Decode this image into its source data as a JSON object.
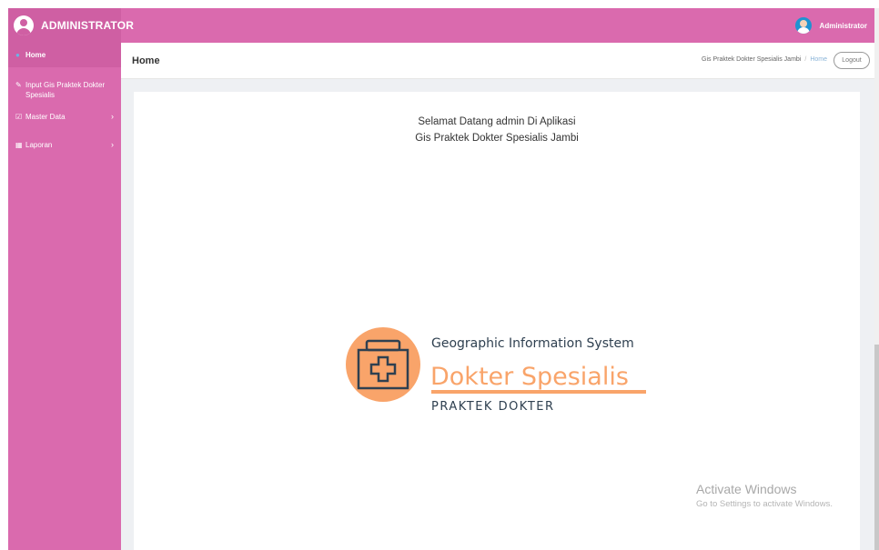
{
  "brand": {
    "title": "ADMINISTRATOR",
    "icon": "user-circle-icon"
  },
  "topbar": {
    "user_name": "Administrator",
    "user_icon": "user-avatar-icon"
  },
  "sidebar": {
    "items": [
      {
        "label": "Home",
        "icon": "dot-icon",
        "active": true
      },
      {
        "label": "Input Gis Praktek Dokter Spesialis",
        "icon": "pencil-icon"
      },
      {
        "label": "Master Data",
        "icon": "edit-icon",
        "has_children": true
      },
      {
        "label": "Laporan",
        "icon": "calendar-icon",
        "has_children": true
      }
    ]
  },
  "header": {
    "title": "Home",
    "breadcrumb": [
      "Gis Praktek Dokter Spesialis Jambi",
      "Home"
    ],
    "breadcrumb_sep": "/",
    "logout_label": "Logout"
  },
  "main": {
    "welcome_line1": "Selamat Datang admin Di Aplikasi",
    "welcome_line2": "Gis Praktek Dokter Spesialis Jambi",
    "logo": {
      "line1": "Geographic Information System",
      "line2": "Dokter Spesialis",
      "line3": "PRAKTEK DOKTER",
      "icon": "medical-bag-icon"
    }
  },
  "watermark": {
    "title": "Activate Windows",
    "subtitle": "Go to Settings to activate Windows."
  },
  "colors": {
    "sidebar": "#da6aae",
    "brand_bg": "#cf5fa3",
    "logo_orange": "#f9a46a",
    "logo_dark": "#2f4050"
  }
}
